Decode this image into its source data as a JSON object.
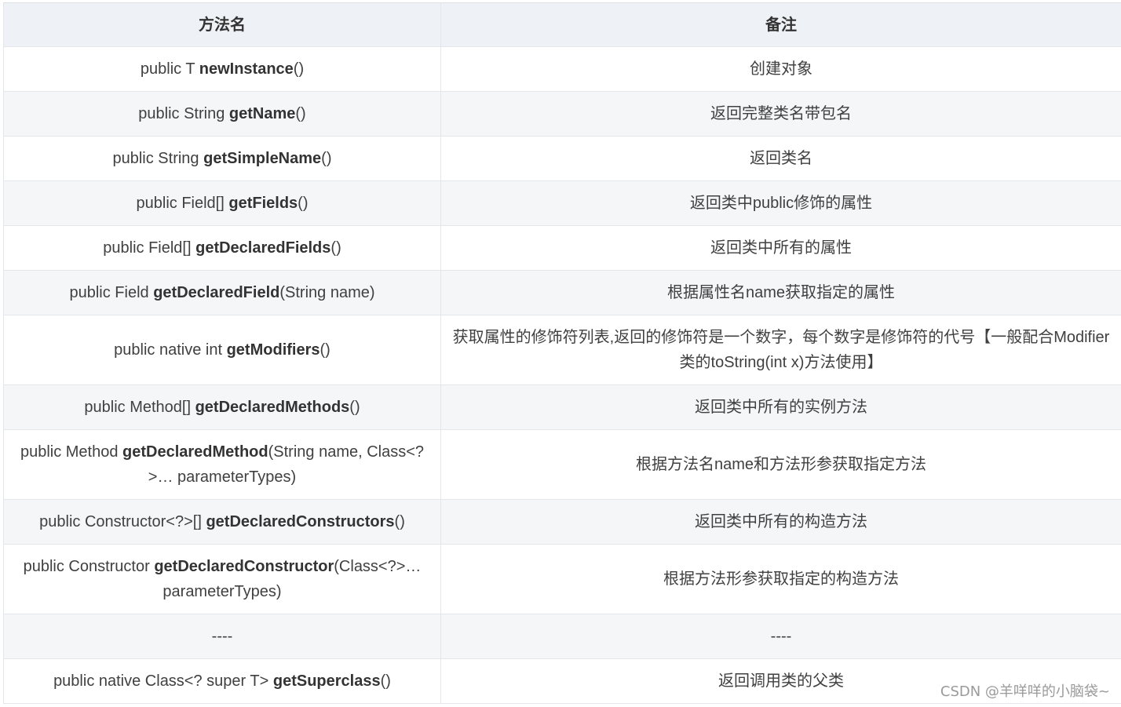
{
  "table": {
    "headers": [
      "方法名",
      "备注"
    ],
    "rows": [
      {
        "prefix": "public T ",
        "method": "newInstance",
        "suffix": "()",
        "note": "创建对象"
      },
      {
        "prefix": "public String ",
        "method": "getName",
        "suffix": "()",
        "note": "返回完整类名带包名"
      },
      {
        "prefix": "public String ",
        "method": "getSimpleName",
        "suffix": "()",
        "note": "返回类名"
      },
      {
        "prefix": "public Field[] ",
        "method": "getFields",
        "suffix": "()",
        "note": "返回类中public修饰的属性"
      },
      {
        "prefix": "public Field[] ",
        "method": "getDeclaredFields",
        "suffix": "()",
        "note": "返回类中所有的属性"
      },
      {
        "prefix": "public Field ",
        "method": "getDeclaredField",
        "suffix": "(String name)",
        "note": "根据属性名name获取指定的属性"
      },
      {
        "prefix": "public native int ",
        "method": "getModifiers",
        "suffix": "()",
        "note": "获取属性的修饰符列表,返回的修饰符是一个数字，每个数字是修饰符的代号【一般配合Modifier类的toString(int x)方法使用】"
      },
      {
        "prefix": "public Method[] ",
        "method": "getDeclaredMethods",
        "suffix": "()",
        "note": "返回类中所有的实例方法"
      },
      {
        "prefix": "public Method ",
        "method": "getDeclaredMethod",
        "suffix": "(String name, Class<?>… parameterTypes)",
        "note": "根据方法名name和方法形参获取指定方法"
      },
      {
        "prefix": "public Constructor<?>[] ",
        "method": "getDeclaredConstructors",
        "suffix": "()",
        "note": "返回类中所有的构造方法"
      },
      {
        "prefix": "public Constructor ",
        "method": "getDeclaredConstructor",
        "suffix": "(Class<?>… parameterTypes)",
        "note": "根据方法形参获取指定的构造方法"
      },
      {
        "prefix": "----",
        "method": "",
        "suffix": "",
        "note": "----"
      },
      {
        "prefix": "public native Class<? super T> ",
        "method": "getSuperclass",
        "suffix": "()",
        "note": "返回调用类的父类"
      }
    ]
  },
  "watermark": "CSDN @羊咩咩的小脑袋~"
}
